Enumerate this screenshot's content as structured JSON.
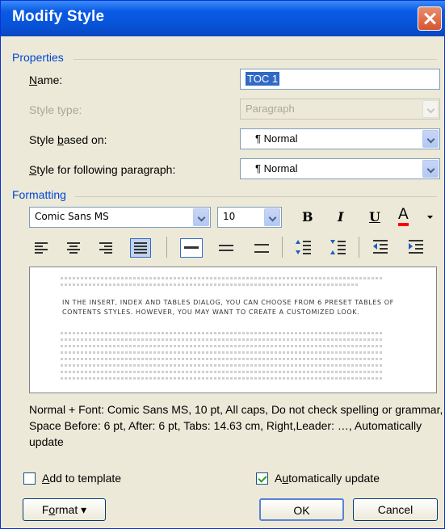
{
  "window": {
    "title": "Modify Style"
  },
  "properties": {
    "section_title": "Properties",
    "name_label": "Name:",
    "name_value": "TOC 1",
    "style_type_label": "Style type:",
    "style_type_value": "Paragraph",
    "based_on_label": "Style based on:",
    "based_on_value": "¶ Normal",
    "following_label": "Style for following paragraph:",
    "following_value": "¶ Normal"
  },
  "formatting": {
    "section_title": "Formatting",
    "font": "Comic Sans MS",
    "size": "10",
    "bold_label": "B",
    "italic_label": "I",
    "underline_label": "U",
    "font_color_label": "A",
    "font_color": "#ff0000"
  },
  "preview": {
    "sample_text": "IN THE INSERT, INDEX AND TABLES DIALOG, YOU CAN CHOOSE FROM 6 PRESET TABLES OF CONTENTS STYLES. HOWEVER, YOU MAY WANT TO CREATE A CUSTOMIZED LOOK."
  },
  "description": "Normal + Font: Comic Sans MS, 10 pt, All caps, Do not check spelling or grammar, Space Before: 6 pt, After: 6 pt, Tabs: 14.63 cm, Right,Leader: …, Automatically update",
  "options": {
    "add_to_template_label": "Add to template",
    "add_to_template_checked": false,
    "auto_update_label": "Automatically update",
    "auto_update_checked": true
  },
  "buttons": {
    "format_label": "Format ▾",
    "ok_label": "OK",
    "cancel_label": "Cancel"
  },
  "colors": {
    "title_bar": "#0a5ae6",
    "section_text": "#0046d5",
    "close_button": "#d7552f"
  }
}
